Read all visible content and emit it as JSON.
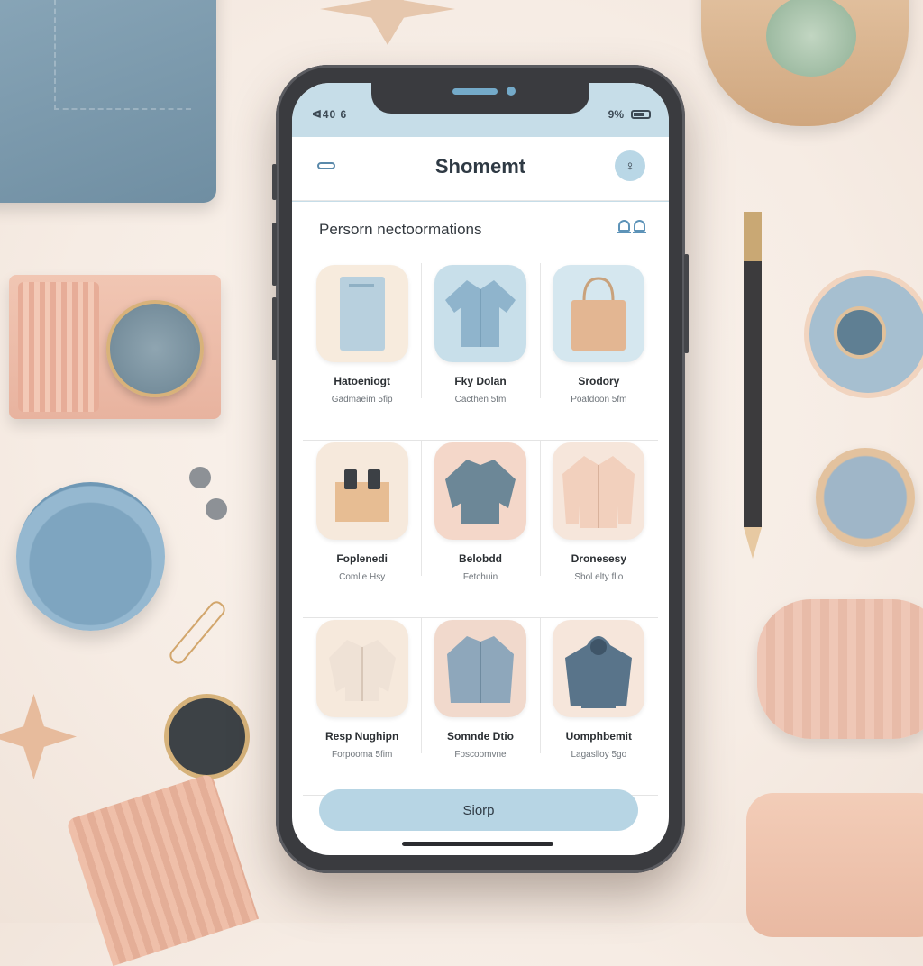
{
  "status_bar": {
    "left": "ᐊ40 6",
    "right": "9%"
  },
  "header": {
    "title": "Shomemt",
    "profile_glyph": "♀"
  },
  "section": {
    "title": "Persorn nectoormations"
  },
  "products": [
    [
      {
        "name": "Hatoeniogt",
        "sub": "Gadmaeim 5fip",
        "thumb_color": "#f7ebdd",
        "icon": "notebook-icon"
      },
      {
        "name": "Fky Dolan",
        "sub": "Cacthen 5fm",
        "thumb_color": "#c8dfea",
        "icon": "shirt-icon"
      },
      {
        "name": "Srodory",
        "sub": "Poafdoon 5fm",
        "thumb_color": "#d5e7ef",
        "icon": "tote-bag-icon"
      }
    ],
    [
      {
        "name": "Foplenedi",
        "sub": "Comlie Hsy",
        "thumb_color": "#f6e9dc",
        "icon": "box-icon"
      },
      {
        "name": "Belobdd",
        "sub": "Fetchuin",
        "thumb_color": "#f4d7c9",
        "icon": "sweater-icon"
      },
      {
        "name": "Dronesesy",
        "sub": "Sbol elty flio",
        "thumb_color": "#f6e6db",
        "icon": "cardigan-icon"
      }
    ],
    [
      {
        "name": "Resp Nughipn",
        "sub": "Forpooma 5fim",
        "thumb_color": "#f6e9dc",
        "icon": "jacket-icon"
      },
      {
        "name": "Somnde Dtio",
        "sub": "Foscoomvne",
        "thumb_color": "#f1d9cc",
        "icon": "knit-jacket-icon"
      },
      {
        "name": "Uomphbemit",
        "sub": "Lagaslloy 5go",
        "thumb_color": "#f6e6db",
        "icon": "hoodie-icon"
      }
    ]
  ],
  "cta": {
    "label": "Siorp"
  },
  "colors": {
    "accent": "#b7d5e4",
    "status_bg": "#c6dde8",
    "text": "#2f3a44"
  }
}
